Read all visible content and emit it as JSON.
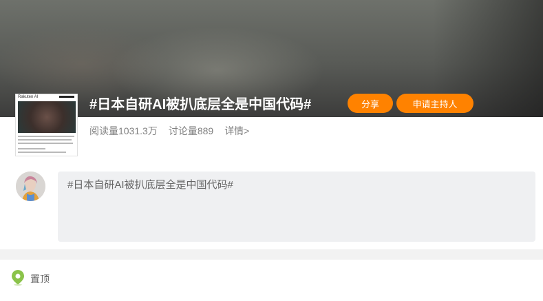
{
  "topic": {
    "title": "#日本自研AI被扒底层全是中国代码#",
    "share_label": "分享",
    "apply_host_label": "申请主持人",
    "stats": {
      "reads": "阅读量1031.3万",
      "discussions": "讨论量889",
      "details": "详情>"
    },
    "cover": {
      "brand": "Rakuten AI"
    }
  },
  "composer": {
    "value": "#日本自研AI被扒底层全是中国代码#"
  },
  "pinned": {
    "label": "置顶"
  },
  "colors": {
    "accent": "#ff8200",
    "pin_green": "#8bc34a"
  },
  "icons": {
    "pin": "pin-location-icon"
  }
}
